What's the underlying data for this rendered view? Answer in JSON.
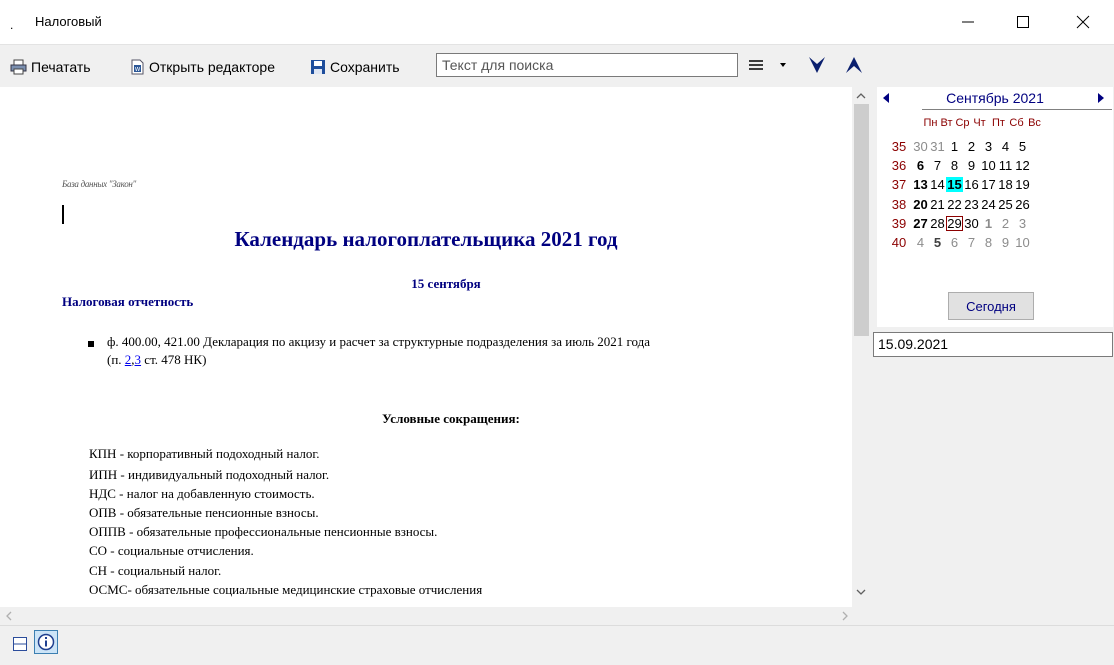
{
  "window": {
    "app_marker": ".",
    "title": "Налоговый",
    "minimize_glyph": "—",
    "maximize_glyph": "☐",
    "close_glyph": "✕"
  },
  "toolbar": {
    "print_label": "Печатать",
    "open_editor_label": "Открыть редакторе",
    "save_label": "Сохранить",
    "search_placeholder": "Текст для поиска",
    "menu_icon": "hamburger-icon",
    "next_icon": "chevron-down-icon",
    "prev_icon": "chevron-up-icon"
  },
  "document": {
    "db_label": "База данных \"Закон\"",
    "title": "Календарь налогоплательщика 2021 год",
    "date": "15 сентября",
    "section": "Налоговая отчетность",
    "item_line1": "ф. 400.00, 421.00 Декларация по акцизу и расчет за структурные подразделения за июль 2021 года",
    "item_prefix": "(п. ",
    "item_link1": "2",
    "item_sep": ",",
    "item_link2": "3",
    "item_suffix": " ст. 478 НК)",
    "abbr_title": "Условные сокращения:",
    "abbreviations": [
      "КПН - корпоративный подоходный налог.",
      "ИПН - индивидуальный подоходный налог.",
      "НДС - налог на добавленную стоимость.",
      "ОПВ - обязательные пенсионные взносы.",
      "ОППВ - обязательные профессиональные пенсионные взносы.",
      "СО - социальные отчисления.",
      "СН - социальный налог.",
      "ОСМС- обязательные социальные медицинские страховые отчисления"
    ]
  },
  "calendar": {
    "month_label": "Сентябрь 2021",
    "day_names": [
      "Пн",
      "Вт",
      "Ср",
      "Чт",
      "Пт",
      "Сб",
      "Вс"
    ],
    "weeks": [
      {
        "num": "35",
        "days": [
          "30",
          "31",
          "1",
          "2",
          "3",
          "4",
          "5"
        ]
      },
      {
        "num": "36",
        "days": [
          "6",
          "7",
          "8",
          "9",
          "10",
          "11",
          "12"
        ]
      },
      {
        "num": "37",
        "days": [
          "13",
          "14",
          "15",
          "16",
          "17",
          "18",
          "19"
        ]
      },
      {
        "num": "38",
        "days": [
          "20",
          "21",
          "22",
          "23",
          "24",
          "25",
          "26"
        ]
      },
      {
        "num": "39",
        "days": [
          "27",
          "28",
          "29",
          "30",
          "1",
          "2",
          "3"
        ]
      },
      {
        "num": "40",
        "days": [
          "4",
          "5",
          "6",
          "7",
          "8",
          "9",
          "10"
        ]
      }
    ],
    "selected_day": "15",
    "today_day": "29",
    "today_button": "Сегодня",
    "date_value": "15.09.2021"
  },
  "statusbar": {
    "layout_icon": "split-view-icon",
    "info_icon": "info-icon"
  },
  "colors": {
    "accent_navy": "#000080",
    "week_red": "#8b0000",
    "selected_cyan": "#00ffff",
    "link_blue": "#0000ee"
  }
}
